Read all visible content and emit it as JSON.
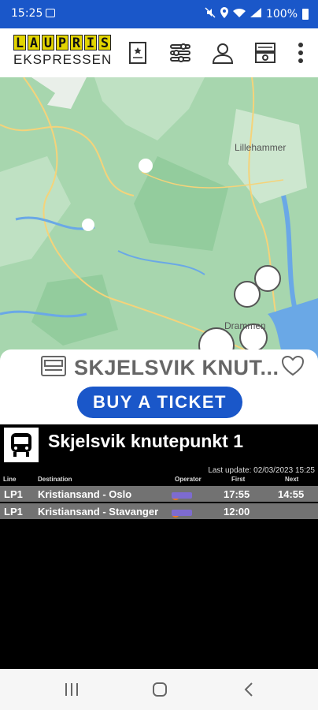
{
  "status_bar": {
    "time": "15:25",
    "battery": "100%"
  },
  "app": {
    "logo_top": [
      "L",
      "A",
      "U",
      "P",
      "R",
      "I",
      "S"
    ],
    "logo_bottom": "EKSPRESSEN"
  },
  "toolbar": {
    "icons": [
      "ticket-card-icon",
      "filter-sliders-icon",
      "account-icon",
      "bus-ticket-icon",
      "overflow-menu-icon"
    ]
  },
  "map": {
    "cities": {
      "lillehammer": "Lillehammer",
      "drammen": "Drammen"
    }
  },
  "stop": {
    "title": "SKJELSVIK KNUT...",
    "buy_label": "BUY A TICKET"
  },
  "board": {
    "stop_name": "Skjelsvik knutepunkt 1",
    "last_update": "Last update: 02/03/2023 15:25",
    "columns": {
      "line": "Line",
      "destination": "Destination",
      "operator": "Operator",
      "first": "First",
      "next": "Next"
    },
    "departures": [
      {
        "line": "LP1",
        "destination": "Kristiansand - Oslo",
        "first": "17:55",
        "next": "14:55"
      },
      {
        "line": "LP1",
        "destination": "Kristiansand - Stavanger",
        "first": "12:00",
        "next": ""
      }
    ]
  },
  "colors": {
    "status_bar": "#1a57c9",
    "button": "#1a57c9",
    "row_bg": "#727272",
    "map_green": "#a7d6ae"
  }
}
